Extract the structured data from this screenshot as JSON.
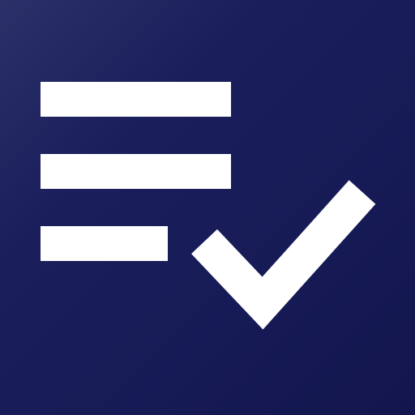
{
  "icon": {
    "name": "checklist-icon",
    "background_color": "#181c57",
    "foreground_color": "#ffffff"
  }
}
